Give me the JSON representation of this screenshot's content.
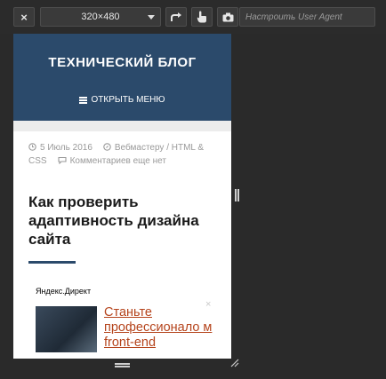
{
  "toolbar": {
    "close_glyph": "×",
    "device_size": "320×480",
    "ua_placeholder": "Настроить User Agent"
  },
  "site": {
    "title": "ТЕХНИЧЕСКИЙ БЛОГ",
    "menu_label": "ОТКРЫТЬ МЕНЮ"
  },
  "post": {
    "date": "5 Июль 2016",
    "category": "Вебмастеру / HTML & CSS",
    "comments": "Комментариев еще нет",
    "title": "Как проверить адаптивность дизайна сайта"
  },
  "ad": {
    "label": "Яндекс.Директ",
    "close_glyph": "×",
    "link_text": "Станьте профессионало м front-end"
  },
  "colors": {
    "devtools_bg": "#2a2a2a",
    "header_bg": "#2b4a6b",
    "ad_link": "#b5441c"
  }
}
